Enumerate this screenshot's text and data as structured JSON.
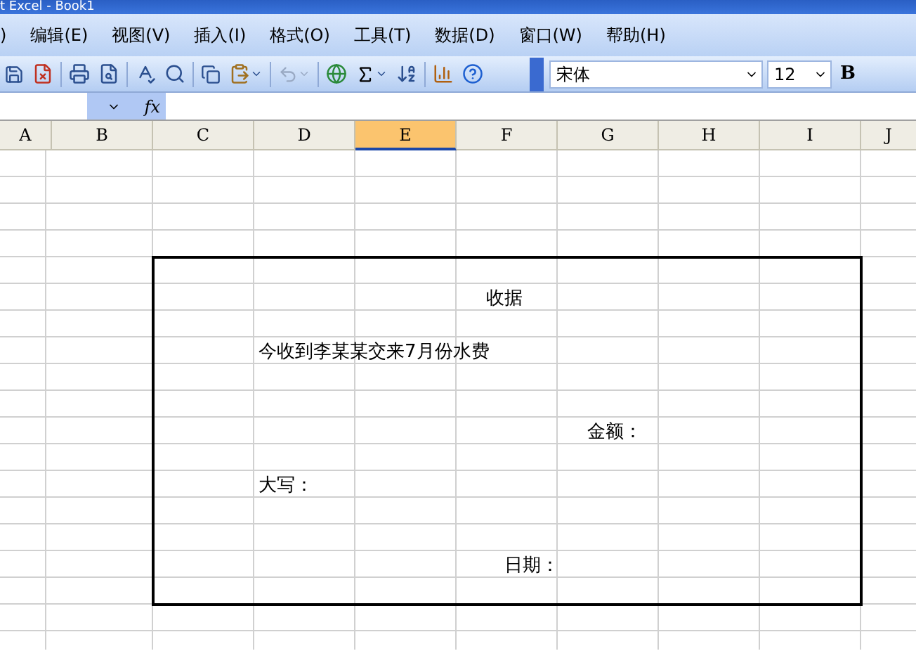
{
  "window": {
    "title": "t Excel - Book1"
  },
  "menu": [
    {
      "label": ")"
    },
    {
      "label": "编辑(E)"
    },
    {
      "label": "视图(V)"
    },
    {
      "label": "插入(I)"
    },
    {
      "label": "格式(O)"
    },
    {
      "label": "工具(T)"
    },
    {
      "label": "数据(D)"
    },
    {
      "label": "窗口(W)"
    },
    {
      "label": "帮助(H)"
    }
  ],
  "toolbar": {
    "font": "宋体",
    "font_size": "12",
    "bold": "B"
  },
  "formula_bar": {
    "fx": "fx"
  },
  "columns": [
    {
      "label": "A",
      "selected": false
    },
    {
      "label": "B",
      "selected": false
    },
    {
      "label": "C",
      "selected": false
    },
    {
      "label": "D",
      "selected": false
    },
    {
      "label": "E",
      "selected": true
    },
    {
      "label": "F",
      "selected": false
    },
    {
      "label": "G",
      "selected": false
    },
    {
      "label": "H",
      "selected": false
    },
    {
      "label": "I",
      "selected": false
    },
    {
      "label": "J",
      "selected": false
    }
  ],
  "receipt": {
    "title": "收据",
    "line": "今收到李某某交来7月份水费",
    "amount_label": "金额：",
    "capital_label": "大写：",
    "date_label": "日期："
  }
}
